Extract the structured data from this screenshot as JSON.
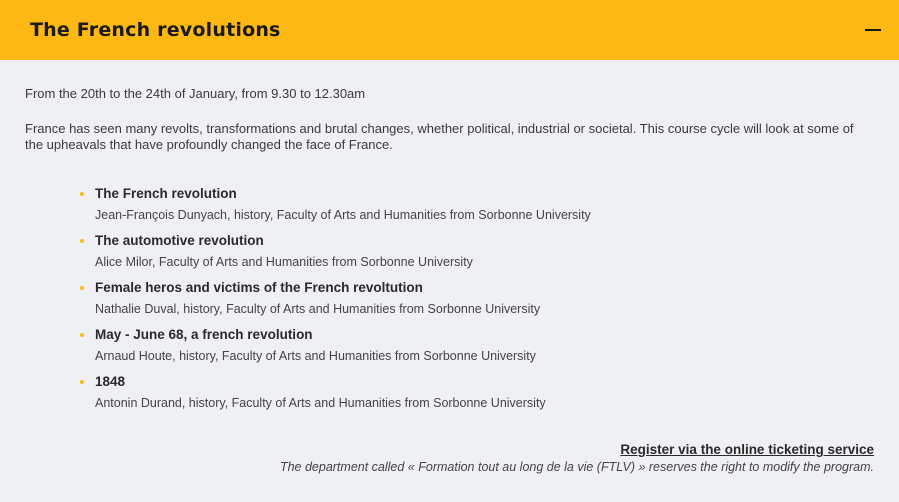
{
  "header": {
    "title": "The French revolutions",
    "toggle_icon": "minus-icon"
  },
  "body": {
    "dates": "From the 20th to the 24th of January, from 9.30 to 12.30am",
    "description": "France has seen many revolts, transformations and brutal changes, whether political, industrial or societal. This course cycle will look at some of the upheavals that have profoundly changed the face of France.",
    "sessions": [
      {
        "title": "The French revolution",
        "speaker": "Jean-François Dunyach, history, Faculty of Arts and Humanities from Sorbonne University"
      },
      {
        "title": "The automotive revolution",
        "speaker": "Alice Milor, Faculty of Arts and Humanities from Sorbonne University"
      },
      {
        "title": "Female heros and victims of the French revoltution",
        "speaker": "Nathalie Duval, history, Faculty of Arts and Humanities from Sorbonne University"
      },
      {
        "title": "May - June 68, a french revolution",
        "speaker": "Arnaud Houte, history, Faculty of Arts and Humanities from Sorbonne University"
      },
      {
        "title": "1848",
        "speaker": "Antonin Durand, history, Faculty of Arts and Humanities from Sorbonne University"
      }
    ],
    "register_link": "Register via the online ticketing service",
    "disclaimer": "The department called « Formation tout au long de la vie (FTLV) » reserves the right to modify the program."
  },
  "colors": {
    "accent": "#fdb813",
    "background": "#eef0f4",
    "text": "#3a3a3a"
  }
}
